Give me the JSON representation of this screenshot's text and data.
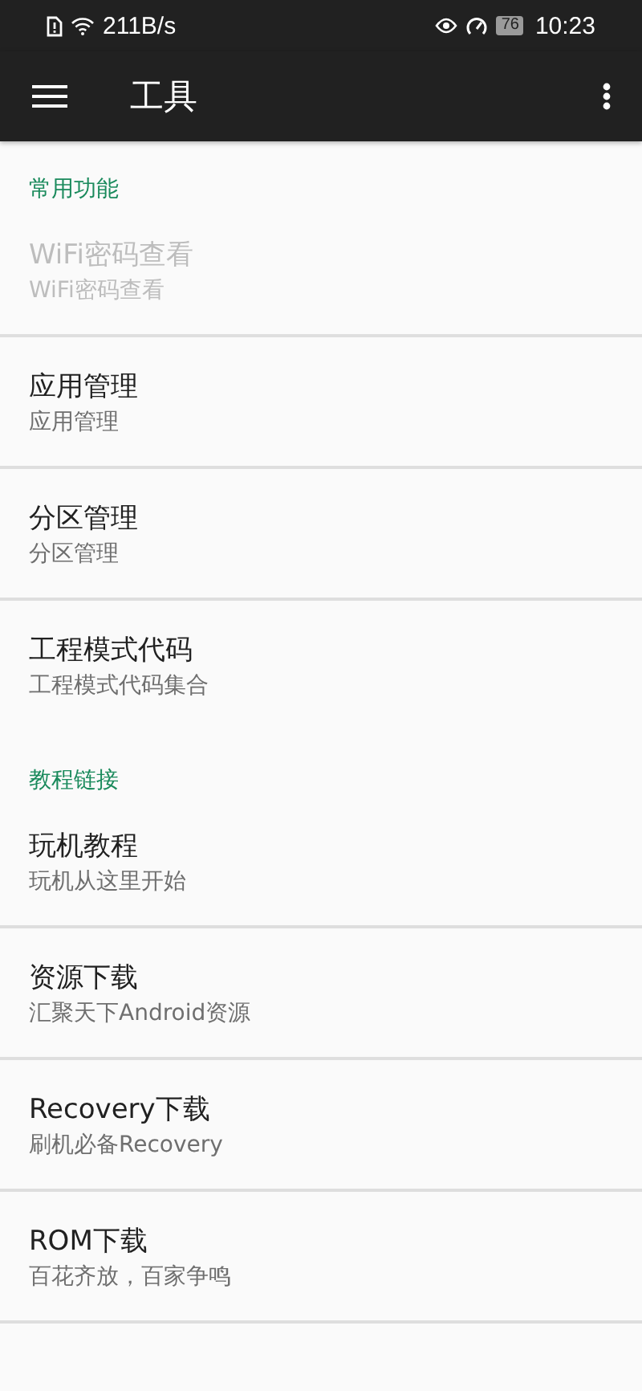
{
  "status_bar": {
    "network_speed": "211B/s",
    "battery": "76",
    "time": "10:23"
  },
  "app_bar": {
    "title": "工具"
  },
  "sections": [
    {
      "header": "常用功能",
      "items": [
        {
          "title": "WiFi密码查看",
          "subtitle": "WiFi密码查看",
          "disabled": true
        },
        {
          "title": "应用管理",
          "subtitle": "应用管理",
          "disabled": false
        },
        {
          "title": "分区管理",
          "subtitle": "分区管理",
          "disabled": false
        },
        {
          "title": "工程模式代码",
          "subtitle": "工程模式代码集合",
          "disabled": false
        }
      ]
    },
    {
      "header": "教程链接",
      "items": [
        {
          "title": "玩机教程",
          "subtitle": "玩机从这里开始",
          "disabled": false
        },
        {
          "title": "资源下载",
          "subtitle": "汇聚天下Android资源",
          "disabled": false
        },
        {
          "title": "Recovery下载",
          "subtitle": "刷机必备Recovery",
          "disabled": false
        },
        {
          "title": "ROM下载",
          "subtitle": "百花齐放，百家争鸣",
          "disabled": false
        }
      ]
    }
  ]
}
